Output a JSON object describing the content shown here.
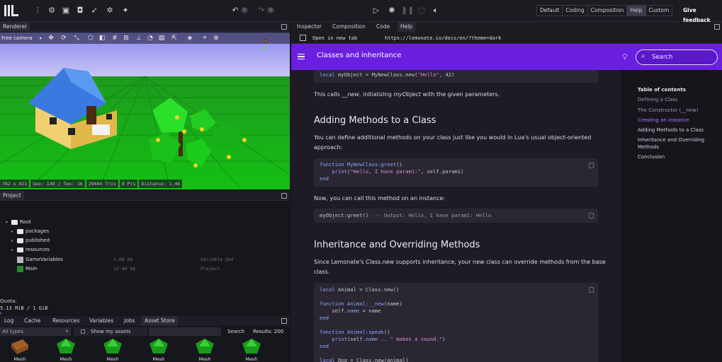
{
  "toolbar": {
    "undo_count": "0",
    "redo_count": "0",
    "modes": [
      "Default",
      "Coding",
      "Composition",
      "Help",
      "Custom"
    ],
    "active_mode": "Help",
    "feedback_label": "Give feedback"
  },
  "renderer": {
    "tab_label": "Renderer",
    "camera_select": "Free camera",
    "status": [
      "782 x 421",
      "Geo: 149 / Tex: 16",
      "29444 Tris",
      "8 Pts",
      "Distance: 1.46"
    ]
  },
  "project": {
    "tab_label": "Project",
    "root_label": "Root",
    "items": [
      {
        "name": "packages",
        "kind": "folder",
        "size": "",
        "type": ""
      },
      {
        "name": "published",
        "kind": "folder",
        "size": "",
        "type": ""
      },
      {
        "name": "resources",
        "kind": "folder",
        "size": "",
        "type": ""
      },
      {
        "name": "GameVariables",
        "kind": "variables",
        "size": "1.09 kb",
        "type": "Variable Set"
      },
      {
        "name": "Main",
        "kind": "project",
        "size": "12.46 kb",
        "type": "Project"
      }
    ]
  },
  "quota": {
    "label": "Quota:",
    "value": "5.13 MiB / 1 GiB",
    "fraction": 0.005
  },
  "bottom_tabs": {
    "items": [
      "Log",
      "Cache",
      "Resources",
      "Variables",
      "Jobs",
      "Asset Store"
    ],
    "active": "Asset Store"
  },
  "asset_store": {
    "type_filter": "All types",
    "show_my_assets": "Show my assets",
    "search_label": "Search",
    "results": "Results: 200",
    "assets": [
      "Mesh",
      "Mesh",
      "Mesh",
      "Mesh",
      "Mesh",
      "Mesh"
    ]
  },
  "right_tabs": {
    "items": [
      "Inspector",
      "Composition",
      "Code",
      "Help"
    ],
    "active": "Help"
  },
  "urlbar": {
    "open_tab_label": "Open in new tab",
    "url": "https://lemonate.io/docs/en/?theme=dark"
  },
  "docs": {
    "page_title": "Classes and inheritance",
    "search_placeholder": "Search",
    "code1": "local myObject = MyNewClass.new(\"Hello\", 42)",
    "p1": {
      "a": "This calls ",
      "b": "__new",
      "c": ", initializing ",
      "d": "myObject",
      "e": " with the given parameters."
    },
    "h2_methods": "Adding Methods to a Class",
    "p2_line1": "You can define additional methods on your class just like you would in Lua's usual object-oriented",
    "p2_line2": "approach:",
    "code2": [
      "function MyNewClass:greet()",
      "    print(\"Hello, I have param1:\", self.param1)",
      "end"
    ],
    "p3": "Now, you can call this method on an instance:",
    "code3": "myObject:greet()  -- Output: Hello, I have param1: Hello",
    "h2_inherit": "Inheritance and Overriding Methods",
    "p4": {
      "a": "Since Lemonate's ",
      "b": "Class.new",
      "c": " supports inheritance, your new class can override methods from the base",
      "d": "class."
    },
    "code4": [
      "local Animal = Class.new()",
      "",
      "function Animal:__new(name)",
      "    self.name = name",
      "end",
      "",
      "function Animal:speak()",
      "    print(self.name .. \" makes a sound.\")",
      "end",
      "",
      "local Dog = Class.new(Animal)"
    ]
  },
  "toc": {
    "title": "Table of contents",
    "items": [
      "Defining a Class",
      "The Constructor (__new)",
      "Creating an instance",
      "Adding Methods to a Class",
      "Inheritance and Overriding",
      "Methods",
      "Conclusion"
    ],
    "active": "Creating an instance"
  },
  "colors": {
    "accent": "#6a1fe0",
    "active_toc": "#a77cff"
  }
}
